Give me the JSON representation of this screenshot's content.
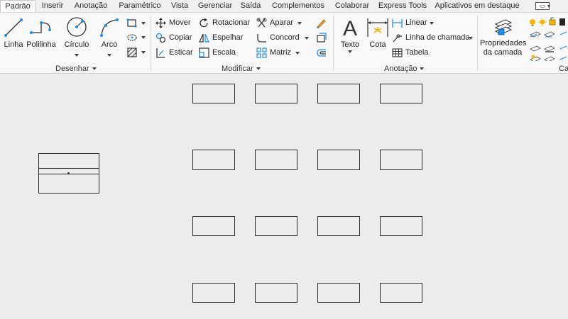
{
  "tabs": [
    "Padrão",
    "Inserir",
    "Anotação",
    "Paramétrico",
    "Vista",
    "Gerenciar",
    "Saída",
    "Complementos",
    "Colaborar",
    "Express Tools",
    "Aplicativos em destaque"
  ],
  "active_tab": "Padrão",
  "panels": {
    "desenhar": {
      "title": "Desenhar",
      "buttons": {
        "linha": "Linha",
        "polilinha": "Polilinha",
        "circulo": "Círculo",
        "arco": "Arco"
      }
    },
    "modificar": {
      "title": "Modificar",
      "buttons": {
        "mover": "Mover",
        "rotacionar": "Rotacionar",
        "aparar": "Aparar",
        "copiar": "Copiar",
        "espelhar": "Espelhar",
        "concord": "Concord",
        "esticar": "Esticar",
        "escala": "Escala",
        "matriz": "Matriz"
      }
    },
    "anotacao": {
      "title": "Anotação",
      "buttons": {
        "texto": "Texto",
        "cota": "Cota",
        "linear": "Linear",
        "linha_chamada": "Linha de chamada",
        "tabela": "Tabela"
      }
    },
    "camadas": {
      "title": "Ca",
      "buttons": {
        "propriedades_l1": "Propriedades",
        "propriedades_l2": "da camada"
      }
    }
  },
  "colors": {
    "accent": "#1f8ee8",
    "ribbon_bg": "#f8f8f8",
    "canvas_bg": "#ececec",
    "layer_yellow": "#f5b400"
  }
}
